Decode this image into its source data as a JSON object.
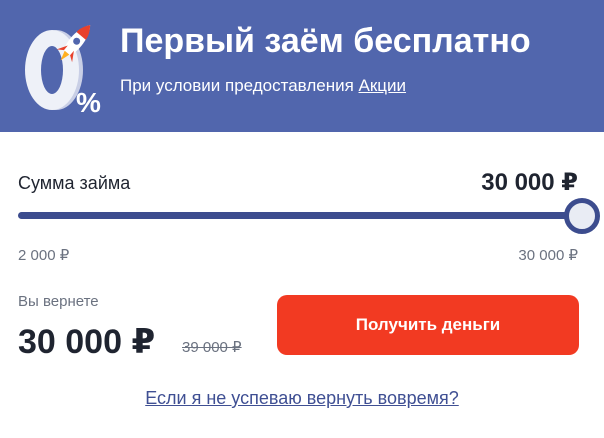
{
  "banner": {
    "title": "Первый заём бесплатно",
    "subtitle_prefix": "При условии предоставления ",
    "subtitle_link": "Акции",
    "graphic_digit": "0",
    "graphic_symbol": "%"
  },
  "loan": {
    "sum_label": "Сумма займа",
    "sum_value": "30 000 ₽",
    "slider": {
      "min": 2000,
      "max": 30000,
      "value": 30000
    },
    "min_label": "2 000 ₽",
    "max_label": "30 000 ₽"
  },
  "repay": {
    "label": "Вы вернете",
    "amount": "30 000 ₽",
    "old_amount": "39 000 ₽"
  },
  "cta": {
    "label": "Получить деньги"
  },
  "help": {
    "link": "Если я не успеваю вернуть вовремя?"
  },
  "colors": {
    "banner_bg": "#5166ad",
    "accent_red": "#f23a22",
    "slider_track": "#3c4c8e",
    "link_blue": "#3f4f93"
  }
}
